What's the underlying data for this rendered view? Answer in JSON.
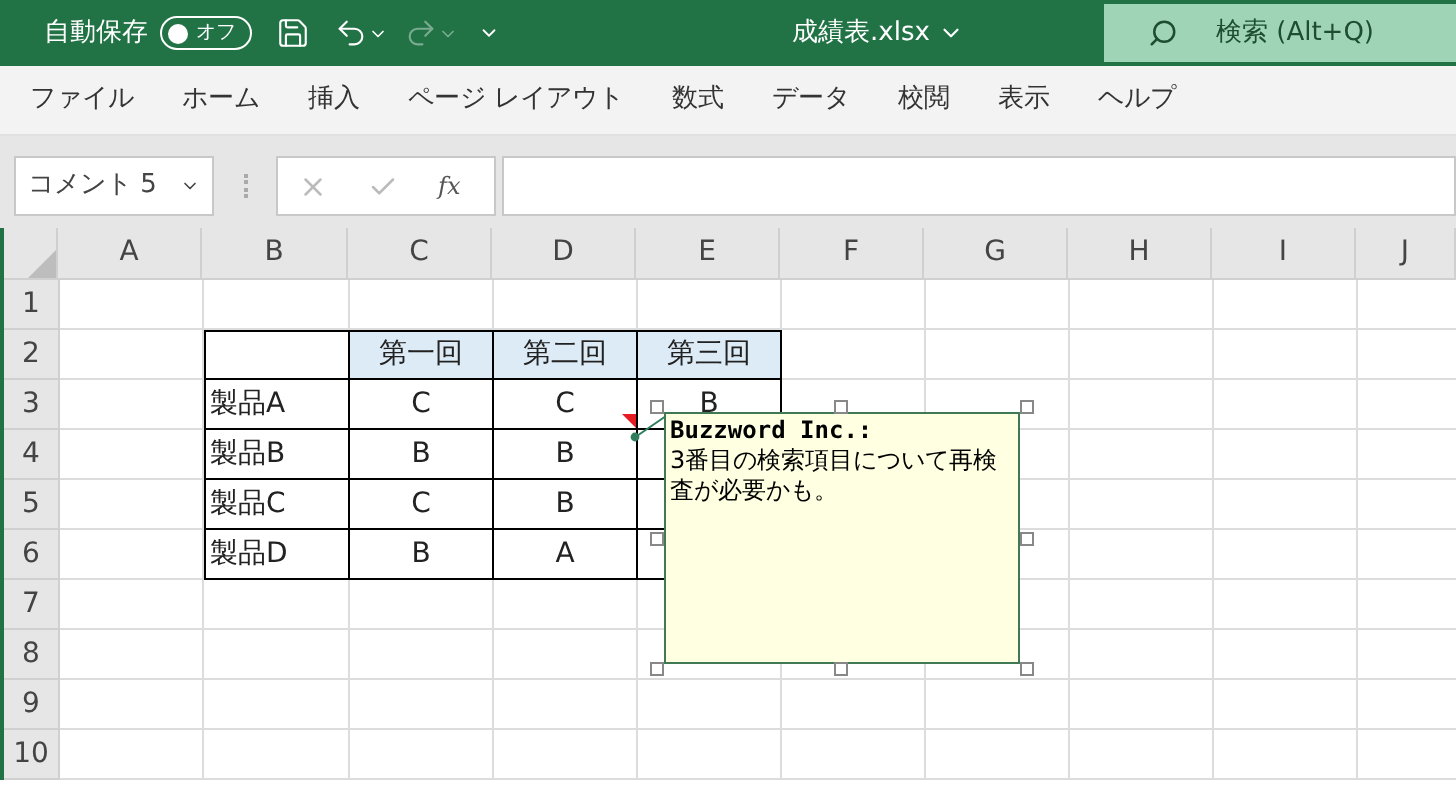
{
  "title_bar": {
    "autosave_label": "自動保存",
    "autosave": {
      "label": "オフ",
      "on": false
    },
    "filename": "成績表.xlsx",
    "search": {
      "placeholder": "検索 (Alt+Q)"
    }
  },
  "ribbon_tabs": [
    "ファイル",
    "ホーム",
    "挿入",
    "ページ レイアウト",
    "数式",
    "データ",
    "校閲",
    "表示",
    "ヘルプ"
  ],
  "formula_bar": {
    "name_box": "コメント 5",
    "fx": "fx"
  },
  "sheet": {
    "columns": [
      "A",
      "B",
      "C",
      "D",
      "E",
      "F",
      "G",
      "H",
      "I",
      "J"
    ],
    "rows": [
      "1",
      "2",
      "3",
      "4",
      "5",
      "6",
      "7",
      "8",
      "9",
      "10"
    ],
    "table": {
      "columns": [
        "第一回",
        "第二回",
        "第三回"
      ],
      "rows": [
        {
          "label": "製品A",
          "values": [
            "C",
            "C",
            "B"
          ]
        },
        {
          "label": "製品B",
          "values": [
            "B",
            "B"
          ]
        },
        {
          "label": "製品C",
          "values": [
            "C",
            "B"
          ]
        },
        {
          "label": "製品D",
          "values": [
            "B",
            "A"
          ]
        }
      ]
    },
    "comment": {
      "author": "Buzzword Inc.:",
      "text": "3番目の検索項目について再検査が必要かも。"
    }
  }
}
